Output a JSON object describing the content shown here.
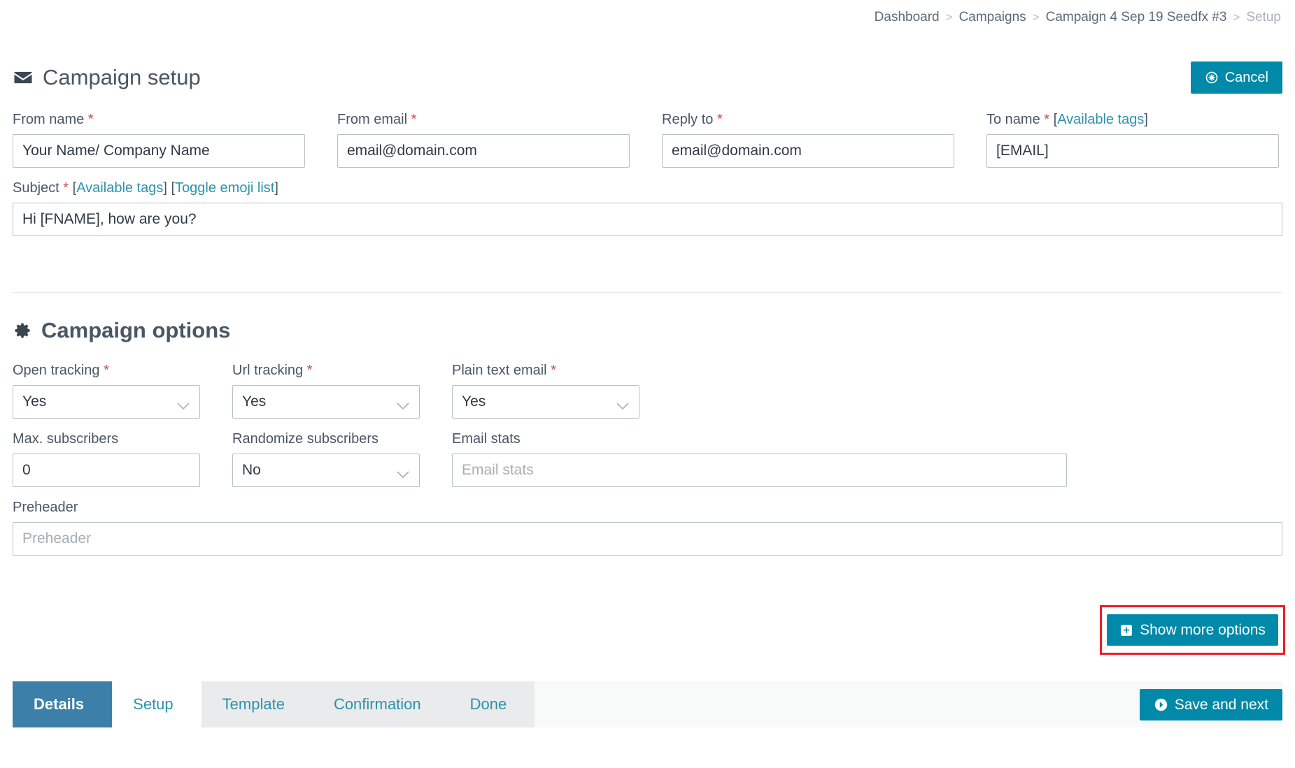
{
  "breadcrumb": {
    "items": [
      {
        "label": "Dashboard",
        "current": false
      },
      {
        "label": "Campaigns",
        "current": false
      },
      {
        "label": "Campaign 4 Sep 19 Seedfx #3",
        "current": false
      },
      {
        "label": "Setup",
        "current": true
      }
    ],
    "separator": ">"
  },
  "header": {
    "icon": "envelope-icon",
    "title": "Campaign setup",
    "cancel": {
      "label": "Cancel",
      "icon": "cancel-circle-icon"
    }
  },
  "setup_form": {
    "from_name": {
      "label": "From name",
      "required": "*",
      "value": "Your Name/ Company Name"
    },
    "from_email": {
      "label": "From email",
      "required": "*",
      "value": "email@domain.com"
    },
    "reply_to": {
      "label": "Reply to",
      "required": "*",
      "value": "email@domain.com"
    },
    "to_name": {
      "label": "To name",
      "required": "*",
      "tags_link": "Available tags",
      "bracket_open": "[",
      "bracket_close": "]",
      "value": "[EMAIL]"
    },
    "subject": {
      "label": "Subject",
      "required": "*",
      "tags_link": "Available tags",
      "emoji_link": "Toggle emoji list",
      "bracket_open": "[",
      "bracket_close": "]",
      "value": "Hi [FNAME], how are you?"
    }
  },
  "options": {
    "icon": "gear-icon",
    "title": "Campaign options",
    "open_tracking": {
      "label": "Open tracking",
      "required": "*",
      "value": "Yes"
    },
    "url_tracking": {
      "label": "Url tracking",
      "required": "*",
      "value": "Yes"
    },
    "plain_text_email": {
      "label": "Plain text email",
      "required": "*",
      "value": "Yes"
    },
    "max_subscribers": {
      "label": "Max. subscribers",
      "value": "0"
    },
    "randomize_subscribers": {
      "label": "Randomize subscribers",
      "value": "No"
    },
    "email_stats": {
      "label": "Email stats",
      "placeholder": "Email stats",
      "value": ""
    },
    "preheader": {
      "label": "Preheader",
      "placeholder": "Preheader",
      "value": ""
    },
    "show_more": {
      "label": "Show more options",
      "icon": "plus-square-icon"
    }
  },
  "wizard": {
    "steps": [
      {
        "label": "Details",
        "state": "active"
      },
      {
        "label": "Setup",
        "state": "current"
      },
      {
        "label": "Template",
        "state": "pending"
      },
      {
        "label": "Confirmation",
        "state": "pending"
      },
      {
        "label": "Done",
        "state": "pending"
      }
    ],
    "save": {
      "label": "Save and next",
      "icon": "arrow-circle-right-icon"
    }
  },
  "colors": {
    "teal": "#0089a8",
    "link": "#2a93ad",
    "active_step": "#3c80a9",
    "required": "#c0515a",
    "highlight": "#ee1c25"
  }
}
